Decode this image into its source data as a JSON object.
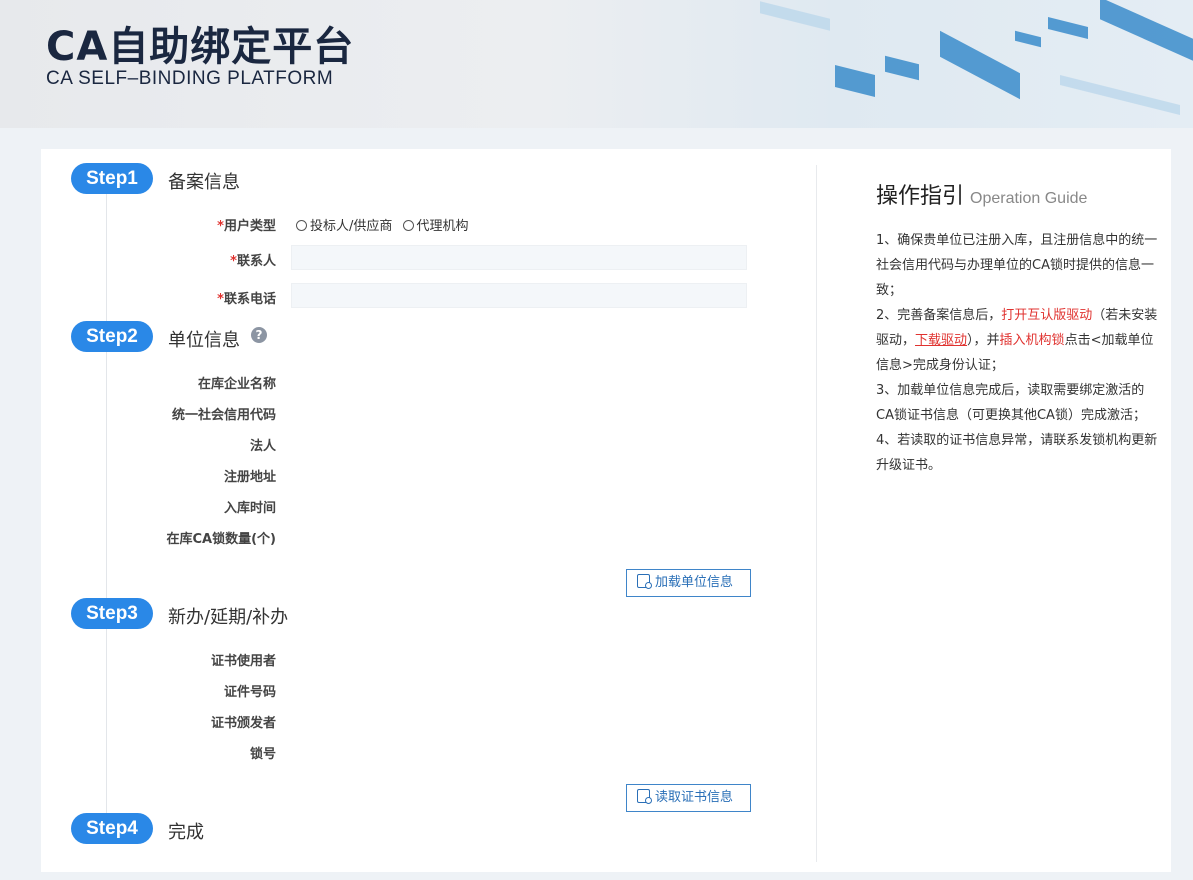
{
  "header": {
    "title": "CA自助绑定平台",
    "subtitle": "CA SELF–BINDING PLATFORM"
  },
  "steps": [
    {
      "badge": "Step1",
      "title": "备案信息"
    },
    {
      "badge": "Step2",
      "title": "单位信息"
    },
    {
      "badge": "Step3",
      "title": "新办/延期/补办"
    },
    {
      "badge": "Step4",
      "title": "完成"
    }
  ],
  "step1": {
    "required_mark": "*",
    "user_type_label": "用户类型",
    "user_type_options": [
      "投标人/供应商",
      "代理机构"
    ],
    "contact_label": "联系人",
    "contact_value": "",
    "phone_label": "联系电话",
    "phone_value": ""
  },
  "step2": {
    "help_icon": "?",
    "fields": [
      "在库企业名称",
      "统一社会信用代码",
      "法人",
      "注册地址",
      "入库时间",
      "在库CA锁数量(个)"
    ],
    "load_button": "加载单位信息"
  },
  "step3": {
    "fields": [
      "证书使用者",
      "证件号码",
      "证书颁发者",
      "锁号"
    ],
    "read_button": "读取证书信息"
  },
  "guide": {
    "title": "操作指引",
    "title_en": "Operation Guide",
    "item1": "1、确保贵单位已注册入库，且注册信息中的统一社会信用代码与办理单位的CA锁时提供的信息一致；",
    "item2_a": "2、完善备案信息后，",
    "item2_red1": "打开互认版驱动",
    "item2_b": "（若未安装驱动，",
    "item2_link": "下载驱动",
    "item2_c": "），并",
    "item2_red2": "插入机构锁",
    "item2_d": "点击<加载单位信息>完成身份认证；",
    "item3": "3、加载单位信息完成后，读取需要绑定激活的CA锁证书信息（可更换其他CA锁）完成激活；",
    "item4": "4、若读取的证书信息异常，请联系发锁机构更新升级证书。"
  },
  "colors": {
    "accent": "#2a88e7",
    "title": "#1a2740",
    "required": "#e0322f",
    "button_border": "#3f85c9"
  },
  "icons": [
    "question-circle-icon",
    "search-doc-icon"
  ]
}
